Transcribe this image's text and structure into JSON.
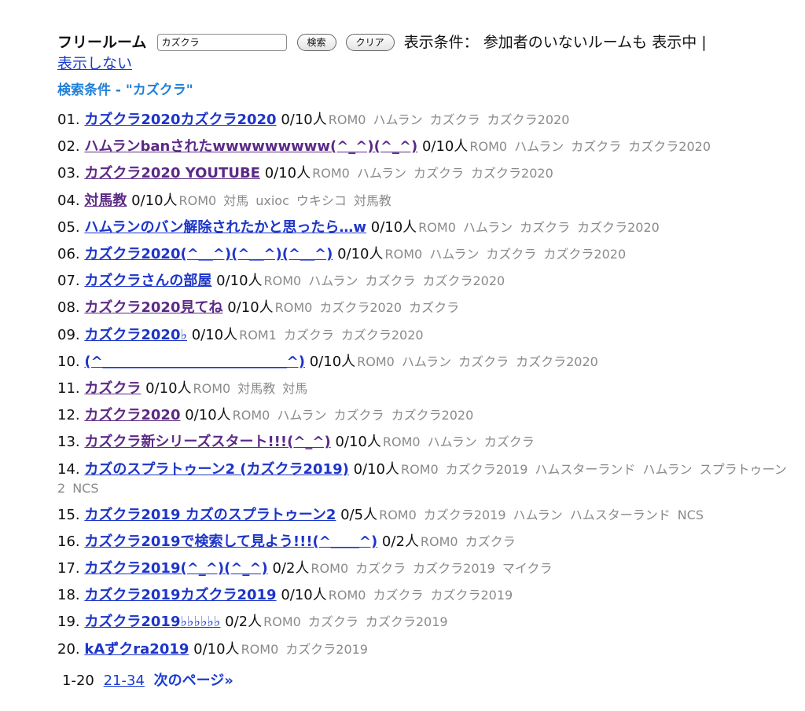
{
  "header": {
    "title": "フリールーム",
    "search_value": "カズクラ",
    "search_button": "検索",
    "clear_button": "クリア",
    "condition_label": "表示条件：",
    "condition_value": "参加者のいないルームも 表示中 |",
    "hide_link": "表示しない"
  },
  "search_condition": "検索条件 - \"カズクラ\"",
  "rooms": [
    {
      "num": "01.",
      "name": "カズクラ2020カズクラ2020",
      "count": "0/10人",
      "rom": "ROM0",
      "tags": [
        "ハムラン",
        "カズクラ",
        "カズクラ2020"
      ]
    },
    {
      "num": "02.",
      "name": "ハムランbanされたwwwwwwwww(^_^)(^_^)",
      "count": "0/10人",
      "rom": "ROM0",
      "tags": [
        "ハムラン",
        "カズクラ",
        "カズクラ2020"
      ]
    },
    {
      "num": "03.",
      "name": "カズクラ2020 YOUTUBE",
      "count": "0/10人",
      "rom": "ROM0",
      "tags": [
        "ハムラン",
        "カズクラ",
        "カズクラ2020"
      ]
    },
    {
      "num": "04.",
      "name": "対馬教",
      "count": "0/10人",
      "rom": "ROM0",
      "tags": [
        "対馬",
        "uxioc",
        "ウキシコ",
        "対馬教"
      ]
    },
    {
      "num": "05.",
      "name": "ハムランのバン解除されたかと思ったら…w",
      "count": "0/10人",
      "rom": "ROM0",
      "tags": [
        "ハムラン",
        "カズクラ",
        "カズクラ2020"
      ]
    },
    {
      "num": "06.",
      "name": "カズクラ2020(^＿^)(^＿^)(^＿^)",
      "count": "0/10人",
      "rom": "ROM0",
      "tags": [
        "ハムラン",
        "カズクラ",
        "カズクラ2020"
      ]
    },
    {
      "num": "07.",
      "name": "カズクラさんの部屋",
      "count": "0/10人",
      "rom": "ROM0",
      "tags": [
        "ハムラン",
        "カズクラ",
        "カズクラ2020"
      ]
    },
    {
      "num": "08.",
      "name": "カズクラ2020見てね",
      "count": "0/10人",
      "rom": "ROM0",
      "tags": [
        "カズクラ2020",
        "カズクラ"
      ]
    },
    {
      "num": "09.",
      "name": "カズクラ2020♭",
      "count": "0/10人",
      "rom": "ROM1",
      "tags": [
        "カズクラ",
        "カズクラ2020"
      ]
    },
    {
      "num": "10.",
      "name": "(^＿＿＿＿＿＿＿＿＿＿＿＿＿^)",
      "count": "0/10人",
      "rom": "ROM0",
      "tags": [
        "ハムラン",
        "カズクラ",
        "カズクラ2020"
      ]
    },
    {
      "num": "11.",
      "name": "カズクラ",
      "count": "0/10人",
      "rom": "ROM0",
      "tags": [
        "対馬教",
        "対馬"
      ]
    },
    {
      "num": "12.",
      "name": "カズクラ2020",
      "count": "0/10人",
      "rom": "ROM0",
      "tags": [
        "ハムラン",
        "カズクラ",
        "カズクラ2020"
      ]
    },
    {
      "num": "13.",
      "name": "カズクラ新シリーズスタート!!!(^_^)",
      "count": "0/10人",
      "rom": "ROM0",
      "tags": [
        "ハムラン",
        "カズクラ"
      ]
    },
    {
      "num": "14.",
      "name": "カズのスプラトゥーン2 (カズクラ2019)",
      "count": "0/10人",
      "rom": "ROM0",
      "tags": [
        "カズクラ2019",
        "ハムスターランド",
        "ハムラン",
        "スプラトゥーン2",
        "NCS"
      ]
    },
    {
      "num": "15.",
      "name": "カズクラ2019 カズのスプラトゥーン2",
      "count": "0/5人",
      "rom": "ROM0",
      "tags": [
        "カズクラ2019",
        "ハムラン",
        "ハムスターランド",
        "NCS"
      ]
    },
    {
      "num": "16.",
      "name": "カズクラ2019で検索して見よう!!!(^＿＿^)",
      "count": "0/2人",
      "rom": "ROM0",
      "tags": [
        "カズクラ"
      ]
    },
    {
      "num": "17.",
      "name": "カズクラ2019(^_^)(^_^)",
      "count": "0/2人",
      "rom": "ROM0",
      "tags": [
        "カズクラ",
        "カズクラ2019",
        "マイクラ"
      ]
    },
    {
      "num": "18.",
      "name": "カズクラ2019カズクラ2019",
      "count": "0/10人",
      "rom": "ROM0",
      "tags": [
        "カズクラ",
        "カズクラ2019"
      ]
    },
    {
      "num": "19.",
      "name": "カズクラ2019♭♭♭♭♭♭",
      "count": "0/2人",
      "rom": "ROM0",
      "tags": [
        "カズクラ",
        "カズクラ2019"
      ]
    },
    {
      "num": "20.",
      "name": "kAずクra2019",
      "count": "0/10人",
      "rom": "ROM0",
      "tags": [
        "カズクラ2019"
      ]
    }
  ],
  "pager": {
    "current": "1-20",
    "page_link": "21-34",
    "next_link": "次のページ»"
  },
  "colors": {
    "link": "#1d35c8",
    "visited": "#5c2a86",
    "search_condition": "#1e7fd8",
    "tag": "#8a8a8a"
  }
}
